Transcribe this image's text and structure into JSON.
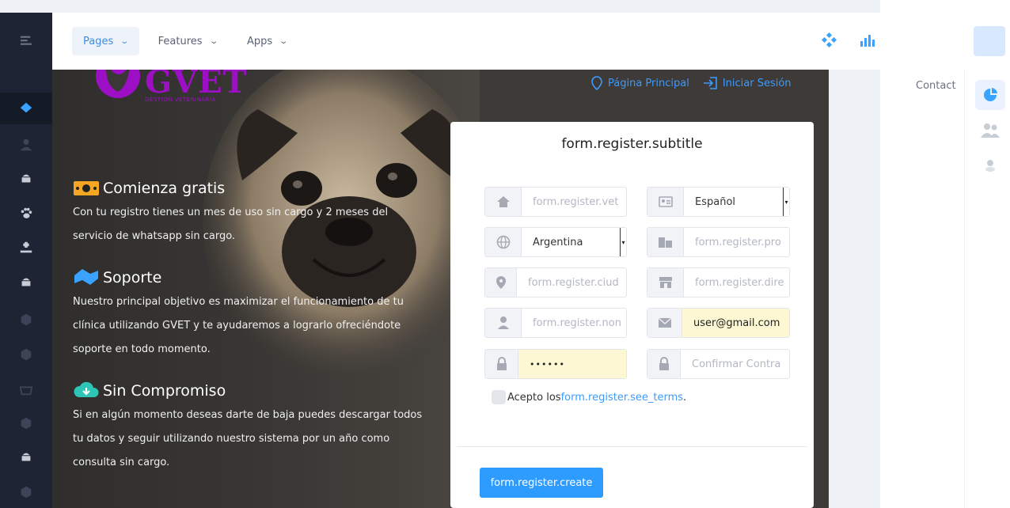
{
  "nav": {
    "menu": [
      {
        "label": "Pages"
      },
      {
        "label": "Features"
      },
      {
        "label": "Apps"
      }
    ]
  },
  "right": {
    "contact": "Contact"
  },
  "hero": {
    "logo": {
      "name": "GVET",
      "tagline": "GESTION VETERINARIA"
    },
    "links": {
      "home": "Página Principal",
      "login": "Iniciar Sesión"
    },
    "features": [
      {
        "title": "Comienza gratis",
        "text": "Con tu registro tienes un mes de uso sin cargo y 2 meses del servicio de whatsapp sin cargo."
      },
      {
        "title": "Soporte",
        "text": "Nuestro principal objetivo es maximizar el funcionamiento de tu clínica utilizando GVET y te ayudaremos a lograrlo ofreciéndote soporte en todo momento."
      },
      {
        "title": "Sin Compromiso",
        "text": "Si en algún momento deseas darte de baja puedes descargar todos tu datos y seguir utilizando nuestro sistema por un año como consulta sin cargo."
      }
    ]
  },
  "form": {
    "subtitle": "form.register.subtitle",
    "vet_placeholder": "form.register.vet",
    "language": "Español",
    "country": "Argentina",
    "province_placeholder": "form.register.pro",
    "city_placeholder": "form.register.ciud",
    "address_placeholder": "form.register.dire",
    "name_placeholder": "form.register.non",
    "email": "user@gmail.com",
    "password": "••••••",
    "confirm_placeholder": "Confirmar Contra",
    "terms_prefix": "Acepto los",
    "terms_link": "form.register.see_terms",
    "terms_suffix": ".",
    "create": "form.register.create"
  },
  "colors": {
    "accent": "#2e9bff",
    "sidebar": "#1e2434",
    "brand": "#9c0fc4"
  }
}
